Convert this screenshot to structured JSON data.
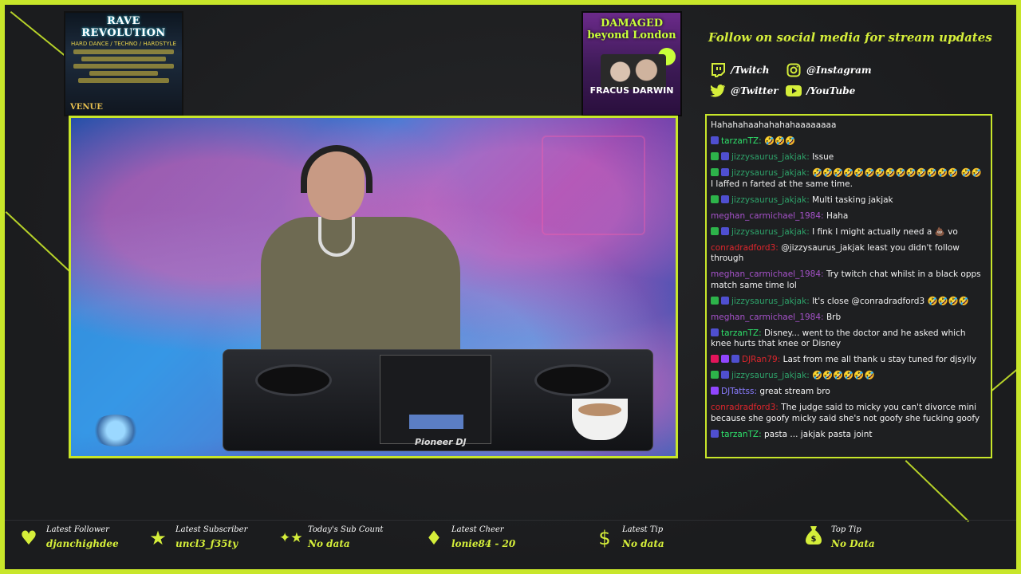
{
  "posters": {
    "left": {
      "title": "RAVE REVOLUTION",
      "subtitle": "HARD DANCE / TECHNO / HARDSTYLE",
      "venue": "VENUE"
    },
    "right": {
      "title": "DAMAGED beyond London",
      "names": "FRACUS DARWIN"
    }
  },
  "social": {
    "title": "Follow on social media for stream updates",
    "twitch": "/Twitch",
    "instagram": "@Instagram",
    "twitter": "@Twitter",
    "youtube": "/YouTube"
  },
  "video": {
    "brand": "Pioneer DJ"
  },
  "chat": [
    {
      "badges": [],
      "user": "",
      "color": "#ffffff",
      "message": "Hahahahaahahahahaaaaaaaa"
    },
    {
      "badges": [
        "sub"
      ],
      "user": "tarzanTZ",
      "color": "#2ee06a",
      "message": "🤣🤣🤣"
    },
    {
      "badges": [
        "mod",
        "sub"
      ],
      "user": "jizzysaurus_jakjak",
      "color": "#2ea36a",
      "message": "Issue"
    },
    {
      "badges": [
        "mod",
        "sub"
      ],
      "user": "jizzysaurus_jakjak",
      "color": "#2ea36a",
      "message": "🤣🤣🤣🤣🤣🤣🤣🤣🤣🤣🤣🤣🤣🤣 🤣🤣 I laffed n farted at the same time."
    },
    {
      "badges": [
        "mod",
        "sub"
      ],
      "user": "jizzysaurus_jakjak",
      "color": "#2ea36a",
      "message": "Multi tasking jakjak"
    },
    {
      "badges": [],
      "user": "meghan_carmichael_1984",
      "color": "#a552c9",
      "message": "Haha"
    },
    {
      "badges": [
        "mod",
        "sub"
      ],
      "user": "jizzysaurus_jakjak",
      "color": "#2ea36a",
      "message": "I fink I might actually need a 💩 vo"
    },
    {
      "badges": [],
      "user": "conradradford3",
      "color": "#e0262c",
      "message": "@jizzysaurus_jakjak least you didn't follow through"
    },
    {
      "badges": [],
      "user": "meghan_carmichael_1984",
      "color": "#a552c9",
      "message": "Try twitch chat whilst in a black opps match same time lol"
    },
    {
      "badges": [
        "mod",
        "sub"
      ],
      "user": "jizzysaurus_jakjak",
      "color": "#2ea36a",
      "message": "It's close @conradradford3 🤣🤣🤣🤣"
    },
    {
      "badges": [],
      "user": "meghan_carmichael_1984",
      "color": "#a552c9",
      "message": "Brb"
    },
    {
      "badges": [
        "sub"
      ],
      "user": "tarzanTZ",
      "color": "#2ee06a",
      "message": "Disney... went to the doctor and he asked which knee hurts that knee or Disney"
    },
    {
      "badges": [
        "vip",
        "prime",
        "sub"
      ],
      "user": "DJRan79",
      "color": "#e0262c",
      "message": "Last from me all thank u stay tuned for djsylly"
    },
    {
      "badges": [
        "mod",
        "sub"
      ],
      "user": "jizzysaurus_jakjak",
      "color": "#2ea36a",
      "message": "🤣🤣🤣🤣🤣🤣"
    },
    {
      "badges": [
        "prime"
      ],
      "user": "DJTattss",
      "color": "#8a7cff",
      "message": "great stream bro"
    },
    {
      "badges": [],
      "user": "conradradford3",
      "color": "#e0262c",
      "message": "The judge said to micky you can't divorce mini because she goofy micky said she's not goofy she fucking goofy"
    },
    {
      "badges": [
        "sub"
      ],
      "user": "tarzanTZ",
      "color": "#2ee06a",
      "message": "pasta ... jakjak pasta joint"
    }
  ],
  "stats": {
    "latest_follower": {
      "label": "Latest Follower",
      "value": "djanchighdee"
    },
    "latest_subscriber": {
      "label": "Latest Subscriber",
      "value": "uncl3_f35ty"
    },
    "sub_count": {
      "label": "Today's Sub Count",
      "value": "No data"
    },
    "latest_cheer": {
      "label": "Latest Cheer",
      "value": "lonie84 - 20"
    },
    "latest_tip": {
      "label": "Latest Tip",
      "value": "No data"
    },
    "top_tip": {
      "label": "Top Tip",
      "value": "No Data"
    }
  },
  "colors": {
    "accent": "#c8e62a",
    "background": "#1c1d1f"
  }
}
